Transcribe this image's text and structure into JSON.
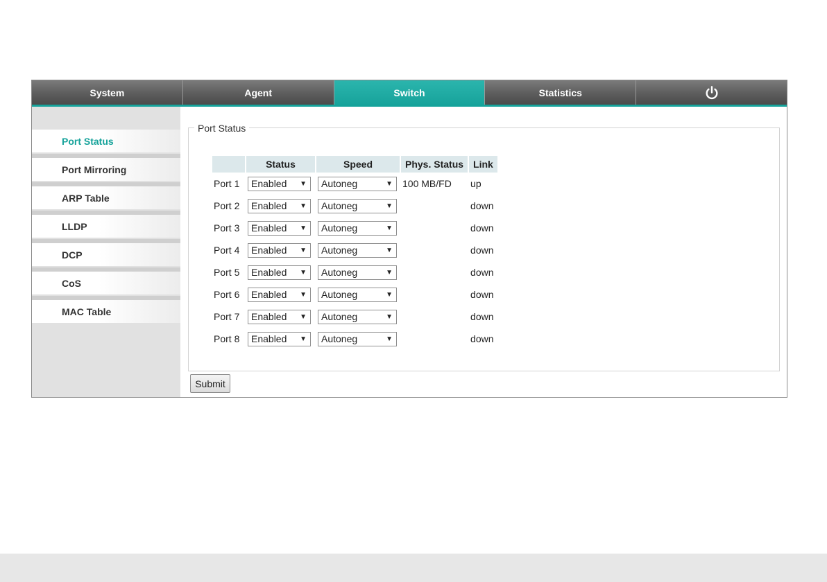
{
  "nav": {
    "tabs": [
      {
        "label": "System"
      },
      {
        "label": "Agent"
      },
      {
        "label": "Switch"
      },
      {
        "label": "Statistics"
      }
    ],
    "power_icon": "power-icon",
    "active_tab": "Switch"
  },
  "sidebar": {
    "items": [
      {
        "label": "Port Status"
      },
      {
        "label": "Port Mirroring"
      },
      {
        "label": "ARP Table"
      },
      {
        "label": "LLDP"
      },
      {
        "label": "DCP"
      },
      {
        "label": "CoS"
      },
      {
        "label": "MAC Table"
      }
    ],
    "active_item": "Port Status"
  },
  "main": {
    "legend": "Port Status",
    "columns": [
      "",
      "Status",
      "Speed",
      "Phys. Status",
      "Link"
    ],
    "rows": [
      {
        "port": "Port 1",
        "status": "Enabled",
        "speed": "Autoneg",
        "phys": "100 MB/FD",
        "link": "up"
      },
      {
        "port": "Port 2",
        "status": "Enabled",
        "speed": "Autoneg",
        "phys": "",
        "link": "down"
      },
      {
        "port": "Port 3",
        "status": "Enabled",
        "speed": "Autoneg",
        "phys": "",
        "link": "down"
      },
      {
        "port": "Port 4",
        "status": "Enabled",
        "speed": "Autoneg",
        "phys": "",
        "link": "down"
      },
      {
        "port": "Port 5",
        "status": "Enabled",
        "speed": "Autoneg",
        "phys": "",
        "link": "down"
      },
      {
        "port": "Port 6",
        "status": "Enabled",
        "speed": "Autoneg",
        "phys": "",
        "link": "down"
      },
      {
        "port": "Port 7",
        "status": "Enabled",
        "speed": "Autoneg",
        "phys": "",
        "link": "down"
      },
      {
        "port": "Port 8",
        "status": "Enabled",
        "speed": "Autoneg",
        "phys": "",
        "link": "down"
      }
    ],
    "dropdown_arrow": "▼",
    "submit_label": "Submit"
  },
  "colors": {
    "accent": "#17a39b",
    "tab_dark": "#5f5f5f",
    "header_cell": "#dce8eb",
    "sidebar_bg": "#e1e1e1"
  }
}
